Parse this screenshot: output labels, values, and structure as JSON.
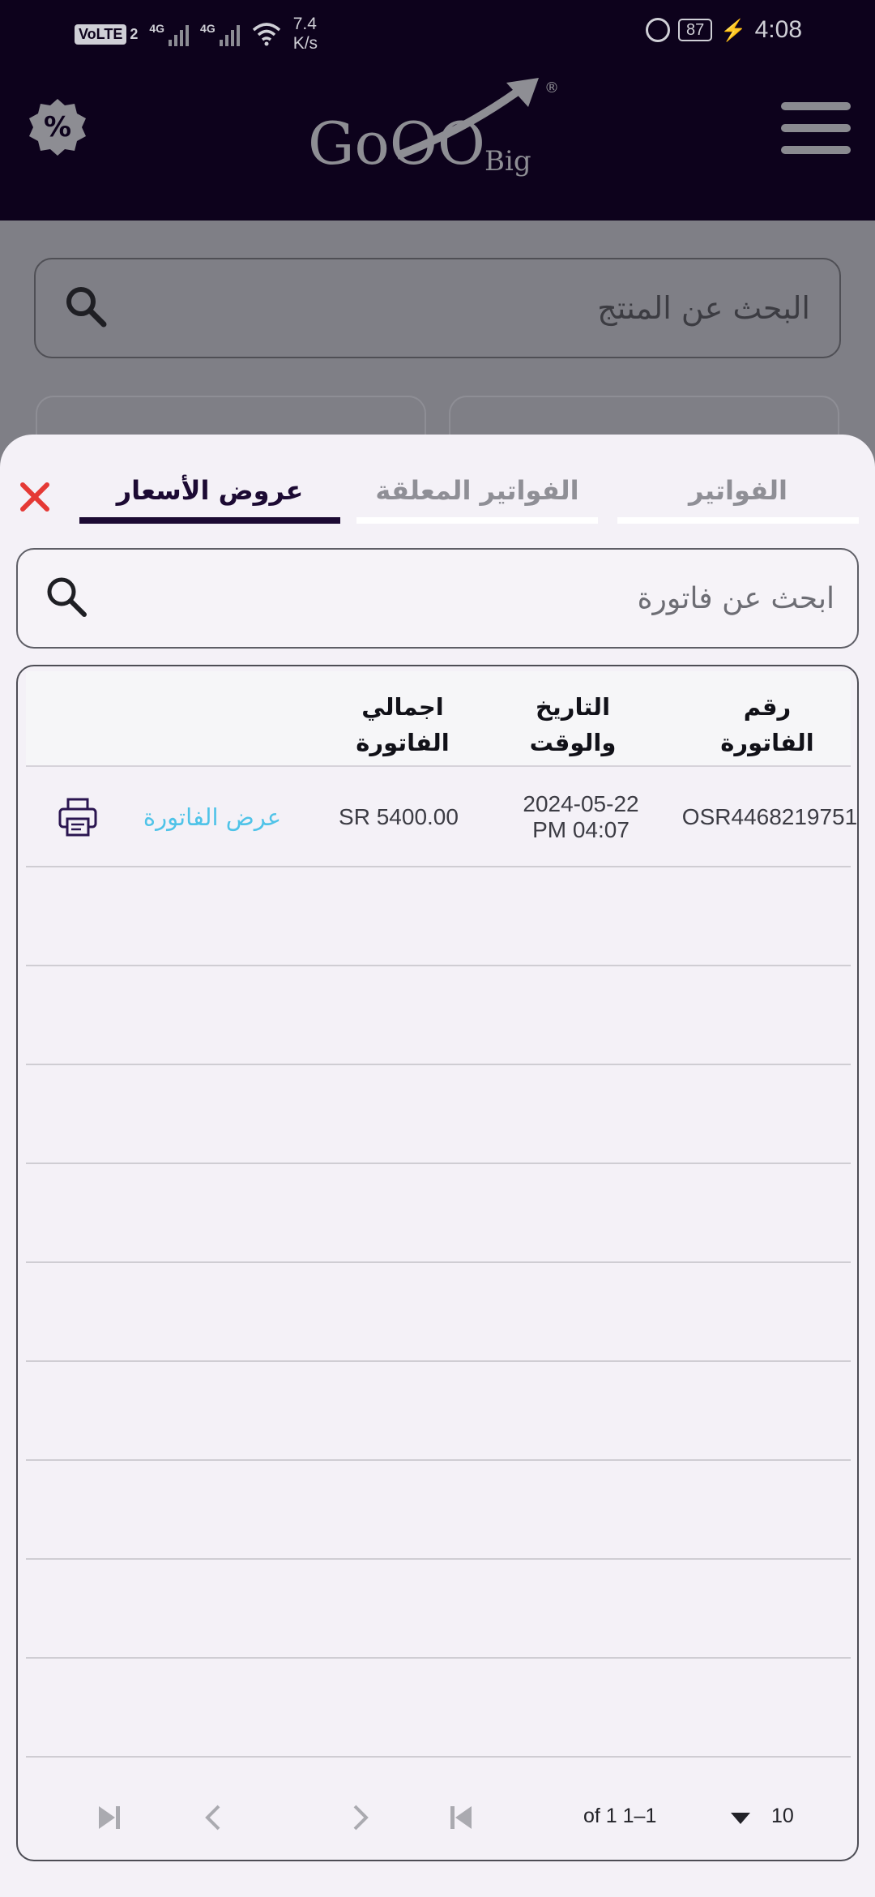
{
  "status_bar": {
    "volte": "VoLTE",
    "sim": "2",
    "net1": "4G",
    "net2": "4G",
    "speed_value": "7.4",
    "speed_unit": "K/s",
    "battery": "87",
    "time": "4:08"
  },
  "header": {
    "logo_text": "GoOO",
    "logo_sub": "Big",
    "logo_mark": "®"
  },
  "page": {
    "search_placeholder": "البحث عن المنتج"
  },
  "sheet": {
    "tabs": [
      {
        "label": "الفواتير",
        "active": false
      },
      {
        "label": "الفواتير المعلقة",
        "active": false
      },
      {
        "label": "عروض الأسعار",
        "active": true
      }
    ],
    "search_placeholder": "ابحث عن فاتورة",
    "table": {
      "columns": {
        "invoice_no_line1": "رقم",
        "invoice_no_line2": "الفاتورة",
        "datetime_line1": "التاريخ",
        "datetime_line2": "والوقت",
        "total_line1": "اجمالي",
        "total_line2": "الفاتورة"
      },
      "rows": [
        {
          "invoice_no": "OSR4468219751",
          "date": "2024-05-22",
          "time": "PM 04:07",
          "total": "SR 5400.00",
          "view_label": "عرض الفاتورة"
        }
      ]
    },
    "pagination": {
      "range": "of 1 1–1",
      "rows_per_page": "10"
    }
  },
  "colors": {
    "header_bg": "#0d021c",
    "accent": "#1c0a33",
    "link": "#4fc3e8",
    "close": "#e53935"
  }
}
